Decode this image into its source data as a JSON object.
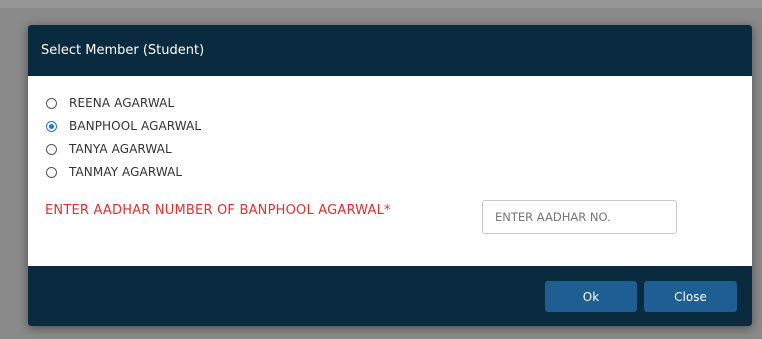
{
  "dialog": {
    "title": "Select Member (Student)",
    "members": [
      {
        "name": "REENA AGARWAL",
        "selected": false
      },
      {
        "name": "BANPHOOL AGARWAL",
        "selected": true
      },
      {
        "name": "TANYA AGARWAL",
        "selected": false
      },
      {
        "name": "TANMAY AGARWAL",
        "selected": false
      }
    ],
    "aadhar_label": "ENTER AADHAR NUMBER OF BANPHOOL AGARWAL*",
    "aadhar_placeholder": "ENTER AADHAR NO.",
    "aadhar_value": "",
    "ok_label": "Ok",
    "close_label": "Close"
  },
  "colors": {
    "header_bg": "#0a2b3f",
    "button_bg": "#1f5e93",
    "label_red": "#e03030",
    "radio_selected": "#1a73e8"
  }
}
